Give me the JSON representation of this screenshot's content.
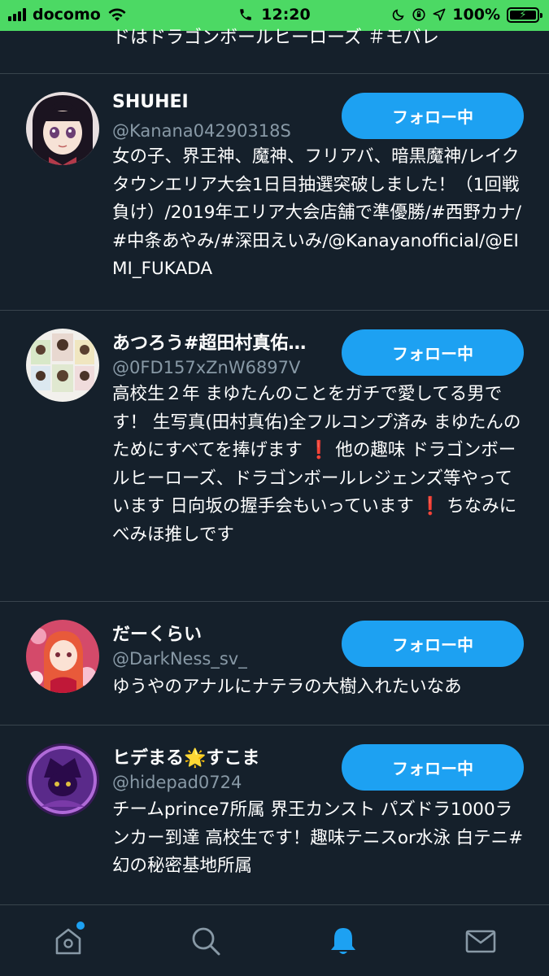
{
  "status_bar": {
    "carrier": "docomo",
    "time": "12:20",
    "battery": "100%"
  },
  "top_bio_fragment": "ドはドラゴンボールヒーローズ ＃モバレ",
  "follow_label": "フォロー中",
  "users": [
    {
      "name": "SHUHEI",
      "handle": "@Kanana04290318S",
      "bio": "女の子、界王神、魔神、フリアバ、暗黒魔神/レイクタウンエリア大会1日目抽選突破しました！（1回戦負け）/2019年エリア大会店舗で準優勝/#西野カナ/#中条あやみ/#深田えいみ/@Kanayanofficial/@EIMI_FUKADA"
    },
    {
      "name": "あつろう#超田村真佑…",
      "handle": "@0FD157xZnW6897V",
      "bio": "高校生２年 まゆたんのことをガチで愛してる男です！ 生写真(田村真佑)全フルコンプ済み まゆたんのためにすべてを捧げます ❗ 他の趣味 ドラゴンボールヒーローズ、ドラゴンボールレジェンズ等やっています 日向坂の握手会もいっています ❗ ちなみにべみほ推しです"
    },
    {
      "name": "だーくらい",
      "handle": "@DarkNess_sv_",
      "bio": "ゆうやのアナルにナテラの大樹入れたいなあ"
    },
    {
      "name": "ヒデまる🌟すこま",
      "handle": "@hidepad0724",
      "bio": "チームprince7所属 界王カンスト パズドラ1000ランカー到達 高校生です！趣味テニスor水泳 白テニ#幻の秘密基地所属"
    }
  ],
  "tabs": [
    {
      "icon": "home-icon",
      "active": false,
      "badge": true
    },
    {
      "icon": "search-icon",
      "active": false
    },
    {
      "icon": "bell-icon",
      "active": true
    },
    {
      "icon": "mail-icon",
      "active": false
    }
  ],
  "colors": {
    "background": "#15202b",
    "accent": "#1da1f2",
    "status_bar": "#4cd964",
    "secondary_text": "#8899a6",
    "divider": "#38444d"
  }
}
